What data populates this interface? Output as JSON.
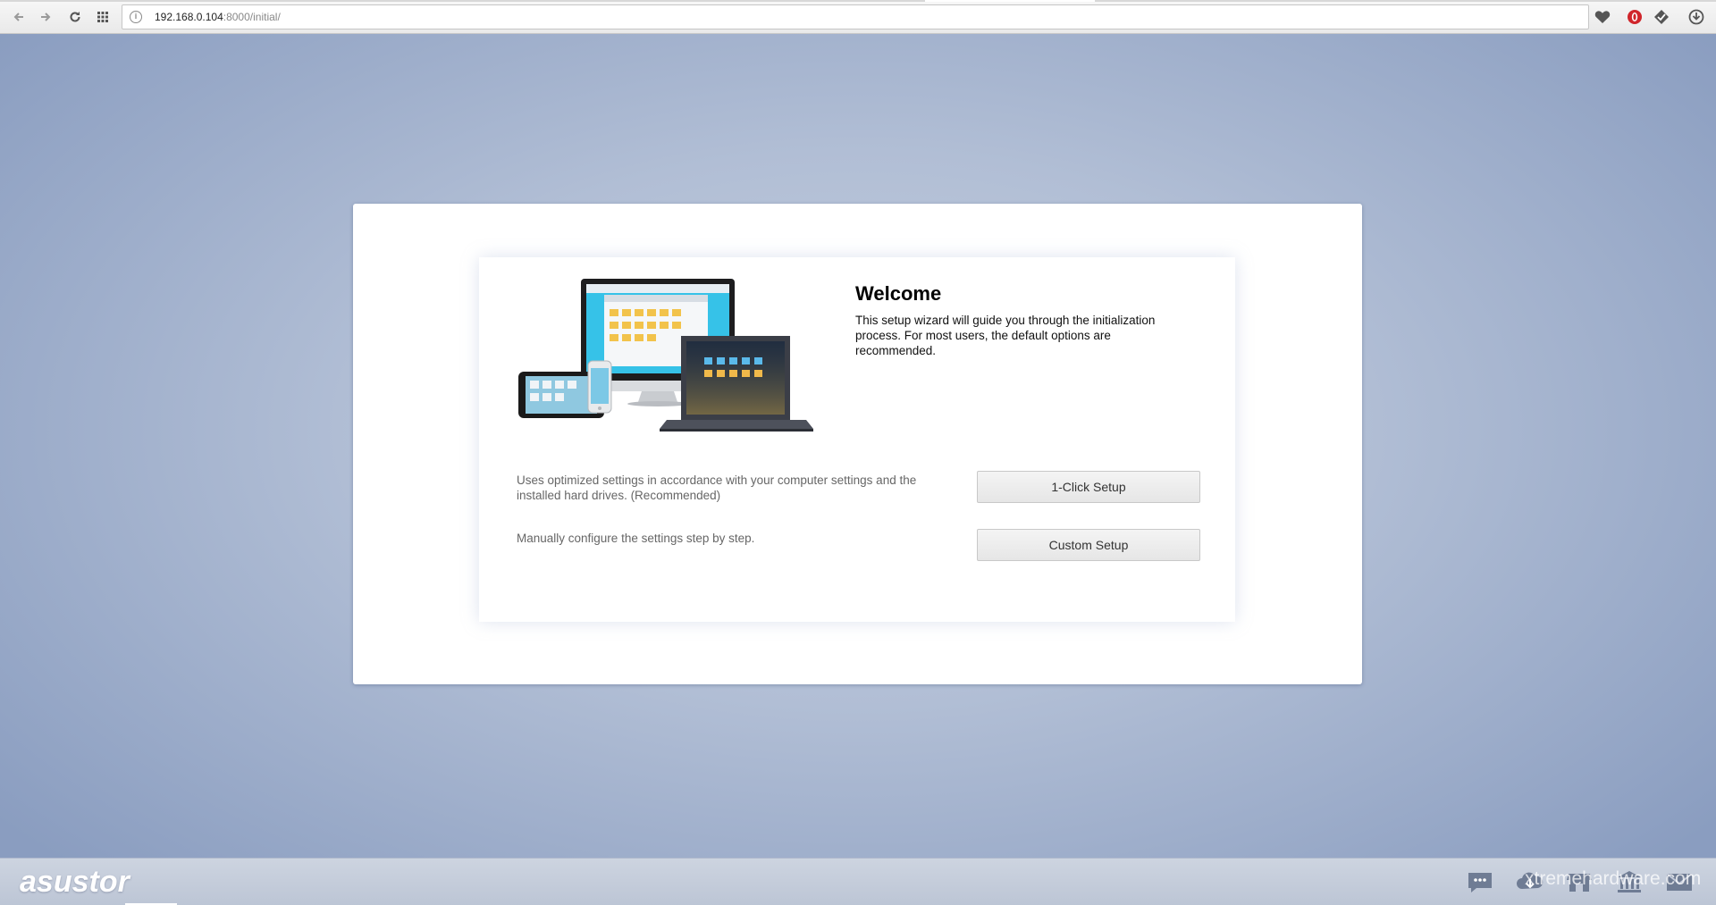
{
  "browser": {
    "url_host": "192.168.0.104",
    "url_rest": ":8000/initial/"
  },
  "wizard": {
    "title": "Welcome",
    "description": "This setup wizard will guide you through the initialization process. For most users, the default options are recommended.",
    "options": [
      {
        "description": "Uses optimized settings in accordance with your computer settings and the installed hard drives. (Recommended)",
        "button_label": "1-Click Setup"
      },
      {
        "description": "Manually configure the settings step by step.",
        "button_label": "Custom Setup"
      }
    ]
  },
  "taskbar": {
    "brand": "asustor",
    "watermark": "xtremehardware.com"
  },
  "colors": {
    "background": "#b1bed5",
    "panel": "#ffffff",
    "button": "#ececec",
    "opera_red": "#d0252b"
  },
  "icons": [
    "back-arrow-icon",
    "forward-arrow-icon",
    "reload-icon",
    "apps-grid-icon",
    "site-info-icon",
    "heart-icon",
    "opera-icon",
    "vpn-icon",
    "download-icon",
    "chat-icon",
    "cloud-download-icon",
    "store-icon",
    "bank-icon",
    "mail-icon"
  ]
}
